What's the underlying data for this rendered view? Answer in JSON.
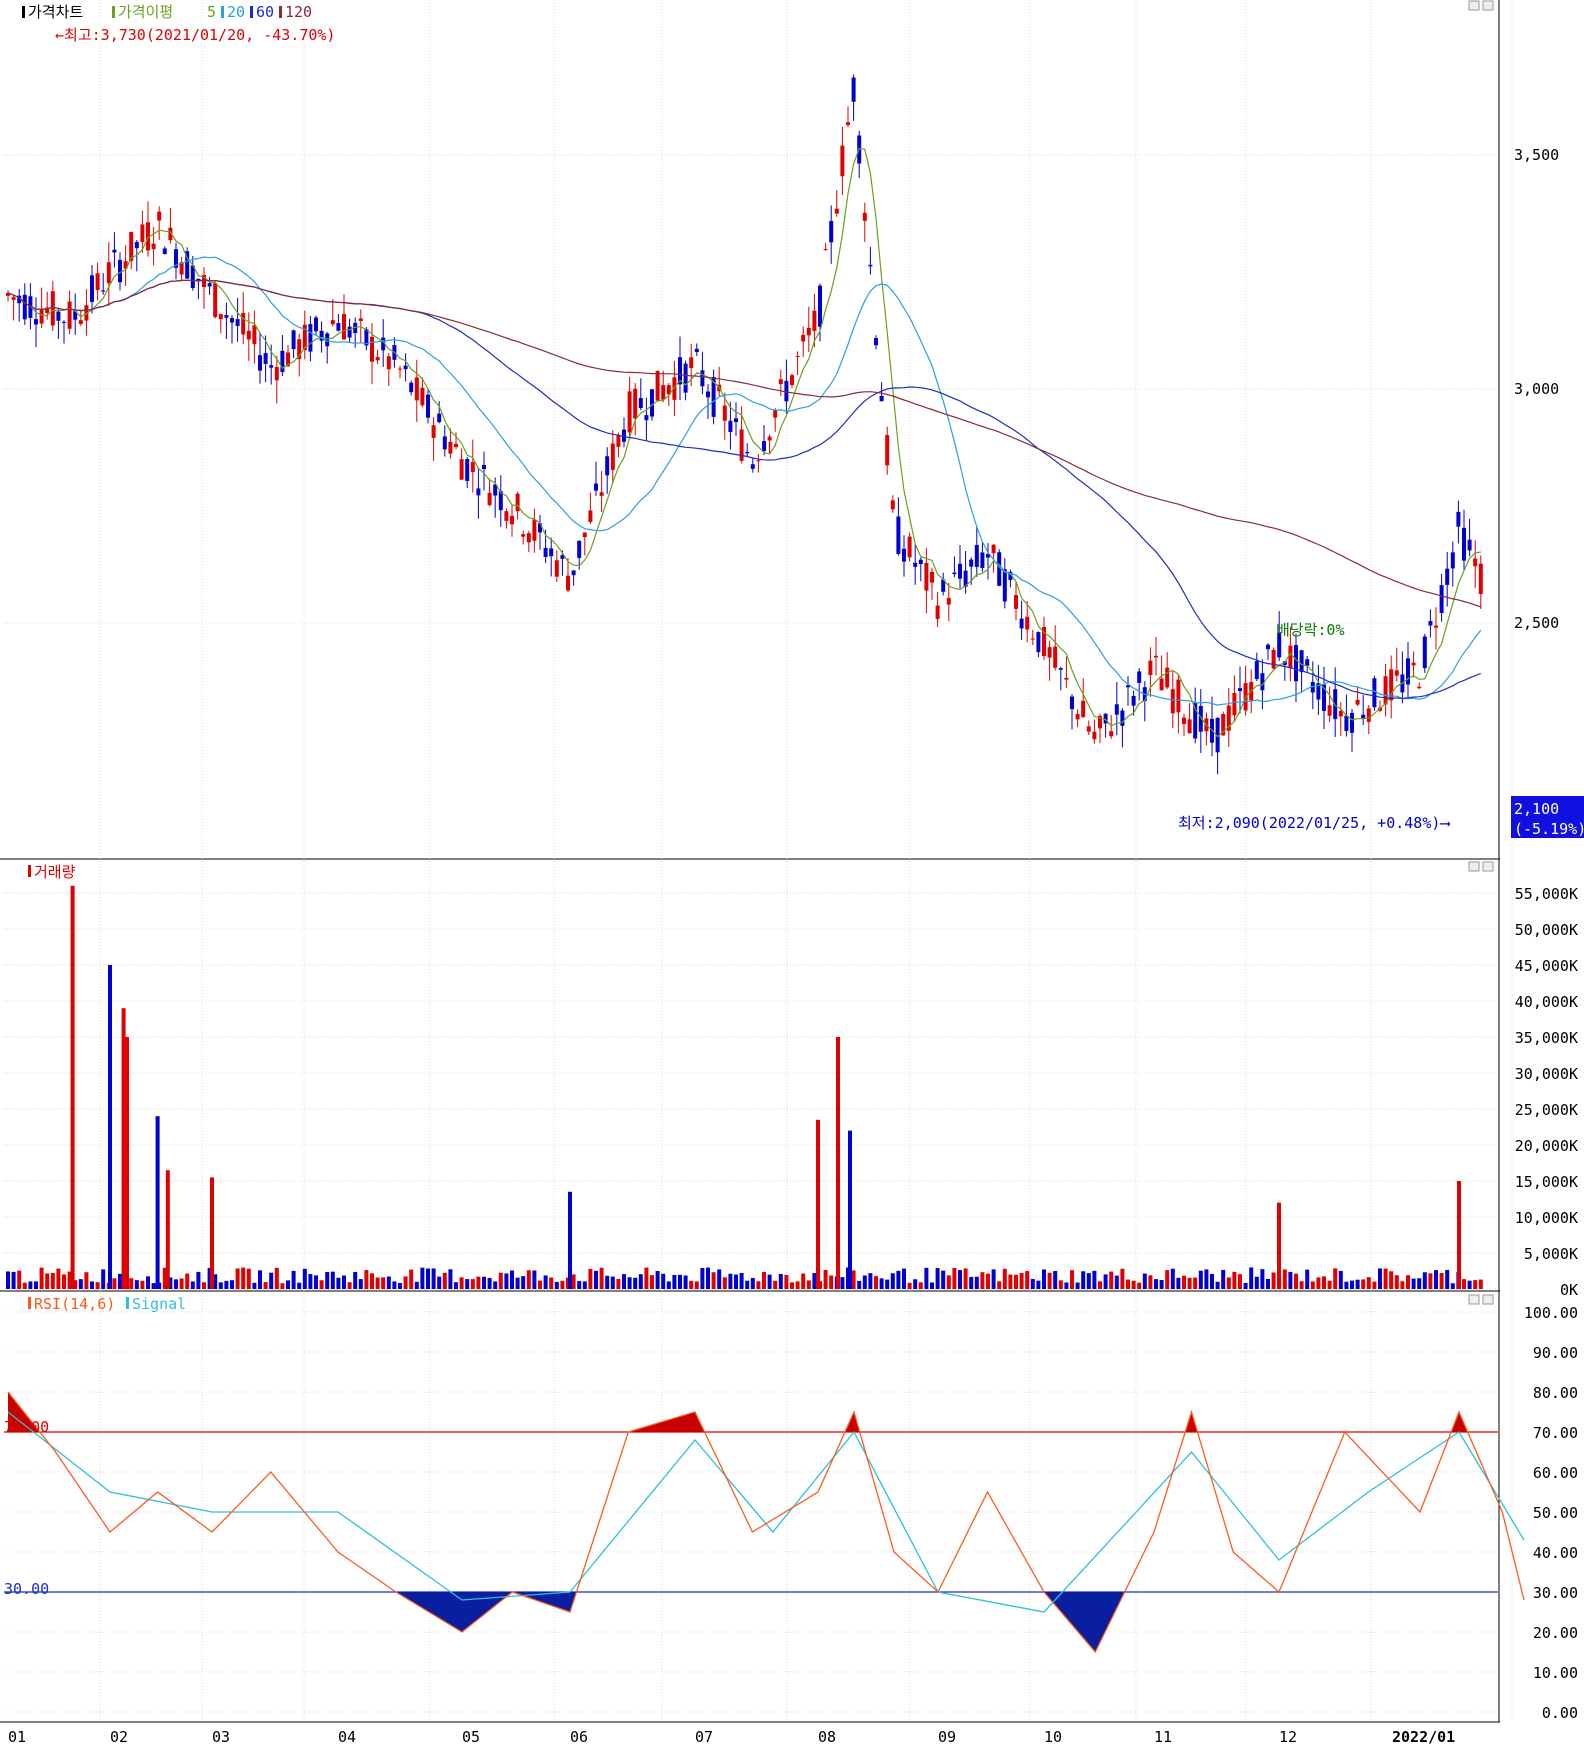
{
  "price_panel": {
    "title": "가격차트",
    "ma_label": "가격이평",
    "ma_periods": [
      "5",
      "20",
      "60",
      "120"
    ],
    "high_annotation": "←최고:3,730(2021/01/20, -43.70%)",
    "low_annotation": "최저:2,090(2022/01/25, +0.48%)⟶",
    "dividend_annotation": "배당락:0%",
    "last_price": "2,100",
    "last_change": "(-5.19%)"
  },
  "volume_panel": {
    "title": "거래량"
  },
  "rsi_panel": {
    "title": "RSI(14,6)",
    "signal_label": "Signal",
    "upper_line_label": "70.00",
    "lower_line_label": "30.00"
  },
  "x_axis_labels": [
    "01",
    "02",
    "03",
    "04",
    "05",
    "06",
    "07",
    "08",
    "09",
    "10",
    "11",
    "12",
    "2022/01"
  ],
  "colors": {
    "up": "#e00000",
    "down": "#0000d0",
    "ma5": "#6aa01e",
    "ma20": "#2aa0e0",
    "ma60": "#1c2cc8",
    "ma120": "#8c2a3c",
    "rsi": "#ff5a1e",
    "signal": "#2ec0d8",
    "grid": "#d8d8d8"
  },
  "chart_data": [
    {
      "type": "candlestick",
      "title": "가격차트",
      "x_range": [
        "2021-01",
        "2022-01"
      ],
      "ylim": [
        1950,
        3750
      ],
      "y_ticks": [
        "2,500",
        "3,000",
        "3,500"
      ],
      "series_names": [
        "가격이평 5",
        "20",
        "60",
        "120"
      ],
      "approx_close_path": [
        [
          "2021-01",
          3200
        ],
        [
          "2021-01-20",
          3150
        ],
        [
          "2021-02-01",
          3250
        ],
        [
          "2021-02-15",
          3350
        ],
        [
          "2021-03-01",
          3200
        ],
        [
          "2021-03-15",
          3050
        ],
        [
          "2021-04-01",
          3150
        ],
        [
          "2021-04-15",
          3050
        ],
        [
          "2021-05-01",
          2850
        ],
        [
          "2021-05-15",
          2750
        ],
        [
          "2021-06-01",
          2600
        ],
        [
          "2021-06-15",
          2950
        ],
        [
          "2021-07-01",
          3050
        ],
        [
          "2021-07-15",
          2850
        ],
        [
          "2021-08-01",
          3150
        ],
        [
          "2021-08-10",
          3650
        ],
        [
          "2021-08-20",
          2700
        ],
        [
          "2021-09-01",
          2550
        ],
        [
          "2021-09-15",
          2650
        ],
        [
          "2021-10-01",
          2450
        ],
        [
          "2021-10-15",
          2250
        ],
        [
          "2021-11-01",
          2400
        ],
        [
          "2021-11-15",
          2250
        ],
        [
          "2021-12-01",
          2450
        ],
        [
          "2021-12-15",
          2300
        ],
        [
          "2022-01-01",
          2400
        ],
        [
          "2022-01-10",
          2700
        ],
        [
          "2022-01-20",
          2500
        ],
        [
          "2022-01-25",
          2100
        ]
      ]
    },
    {
      "type": "bar",
      "title": "거래량",
      "ylim": [
        0,
        55000
      ],
      "y_ticks": [
        "0K",
        "5,000K",
        "10,000K",
        "15,000K",
        "20,000K",
        "25,000K",
        "30,000K",
        "35,000K",
        "40,000K",
        "45,000K",
        "50,000K",
        "55,000K"
      ],
      "spikes_k": [
        [
          "2021-01-20",
          56000
        ],
        [
          "2021-02-01",
          45000
        ],
        [
          "2021-02-05",
          39000
        ],
        [
          "2021-02-06",
          35000
        ],
        [
          "2021-02-15",
          24000
        ],
        [
          "2021-02-18",
          16500
        ],
        [
          "2021-03-01",
          15500
        ],
        [
          "2021-06-01",
          13500
        ],
        [
          "2021-08-01",
          23500
        ],
        [
          "2021-08-06",
          35000
        ],
        [
          "2021-08-09",
          22000
        ],
        [
          "2021-12-01",
          12000
        ],
        [
          "2022-01-10",
          15000
        ]
      ]
    },
    {
      "type": "line",
      "title": "RSI(14,6)",
      "ylim": [
        0,
        100
      ],
      "y_ticks": [
        "0.00",
        "10.00",
        "20.00",
        "30.00",
        "40.00",
        "50.00",
        "60.00",
        "70.00",
        "80.00",
        "90.00",
        "100.00"
      ],
      "reference_lines": [
        70,
        30
      ],
      "series": [
        {
          "name": "RSI(14,6)",
          "values": [
            [
              "2021-01",
              80
            ],
            [
              "2021-01-15",
              65
            ],
            [
              "2021-02-01",
              45
            ],
            [
              "2021-02-15",
              55
            ],
            [
              "2021-03-01",
              45
            ],
            [
              "2021-03-15",
              60
            ],
            [
              "2021-04-01",
              40
            ],
            [
              "2021-04-15",
              30
            ],
            [
              "2021-05-01",
              20
            ],
            [
              "2021-05-15",
              30
            ],
            [
              "2021-06-01",
              25
            ],
            [
              "2021-06-15",
              70
            ],
            [
              "2021-07-01",
              75
            ],
            [
              "2021-07-15",
              45
            ],
            [
              "2021-08-01",
              55
            ],
            [
              "2021-08-10",
              75
            ],
            [
              "2021-08-20",
              40
            ],
            [
              "2021-09-01",
              30
            ],
            [
              "2021-09-15",
              55
            ],
            [
              "2021-10-01",
              30
            ],
            [
              "2021-10-15",
              15
            ],
            [
              "2021-11-01",
              45
            ],
            [
              "2021-11-10",
              75
            ],
            [
              "2021-11-20",
              40
            ],
            [
              "2021-12-01",
              30
            ],
            [
              "2021-12-15",
              70
            ],
            [
              "2022-01-01",
              50
            ],
            [
              "2022-01-10",
              75
            ],
            [
              "2022-01-20",
              50
            ],
            [
              "2022-01-25",
              28
            ]
          ]
        },
        {
          "name": "Signal",
          "values": [
            [
              "2021-01",
              75
            ],
            [
              "2021-02-01",
              55
            ],
            [
              "2021-03-01",
              50
            ],
            [
              "2021-04-01",
              50
            ],
            [
              "2021-05-01",
              28
            ],
            [
              "2021-06-01",
              30
            ],
            [
              "2021-07-01",
              68
            ],
            [
              "2021-07-20",
              45
            ],
            [
              "2021-08-10",
              70
            ],
            [
              "2021-09-01",
              30
            ],
            [
              "2021-10-01",
              25
            ],
            [
              "2021-11-10",
              65
            ],
            [
              "2021-12-01",
              38
            ],
            [
              "2021-12-20",
              55
            ],
            [
              "2022-01-10",
              70
            ],
            [
              "2022-01-25",
              43
            ]
          ]
        }
      ]
    }
  ]
}
